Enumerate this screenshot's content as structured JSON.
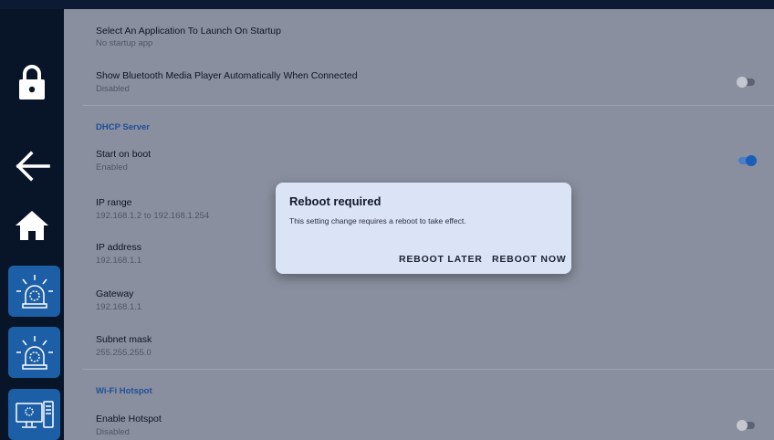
{
  "rows": [
    {
      "title": "Select An Application To Launch On Startup",
      "sub": "No startup app"
    },
    {
      "title": "Show Bluetooth Media Player Automatically When Connected",
      "sub": "Disabled"
    },
    {
      "title": "Start on boot",
      "sub": "Enabled"
    },
    {
      "title": "IP range",
      "sub": "192.168.1.2 to 192.168.1.254"
    },
    {
      "title": "IP address",
      "sub": "192.168.1.1"
    },
    {
      "title": "Gateway",
      "sub": "192.168.1.1"
    },
    {
      "title": "Subnet mask",
      "sub": "255.255.255.0"
    },
    {
      "title": "Enable Hotspot",
      "sub": "Disabled"
    }
  ],
  "sections": {
    "dhcp": "DHCP Server",
    "wifi": "Wi-Fi Hotspot"
  },
  "toggles": {
    "bluetooth_player": false,
    "start_on_boot": true,
    "hotspot": false
  },
  "sidebar": {
    "icons": [
      "lock-icon",
      "back-arrow-icon",
      "home-icon",
      "alarm-beacon-icon",
      "alarm-beacon-icon",
      "computer-monitor-icon"
    ]
  },
  "dialog": {
    "title": "Reboot required",
    "message": "This setting change requires a reboot to take effect.",
    "later": "REBOOT LATER",
    "now": "REBOOT NOW"
  },
  "colors": {
    "accent": "#1a5eb8",
    "section": "#1d4f9a",
    "tile": "#1d5fa6",
    "sidebar": "#081428"
  }
}
